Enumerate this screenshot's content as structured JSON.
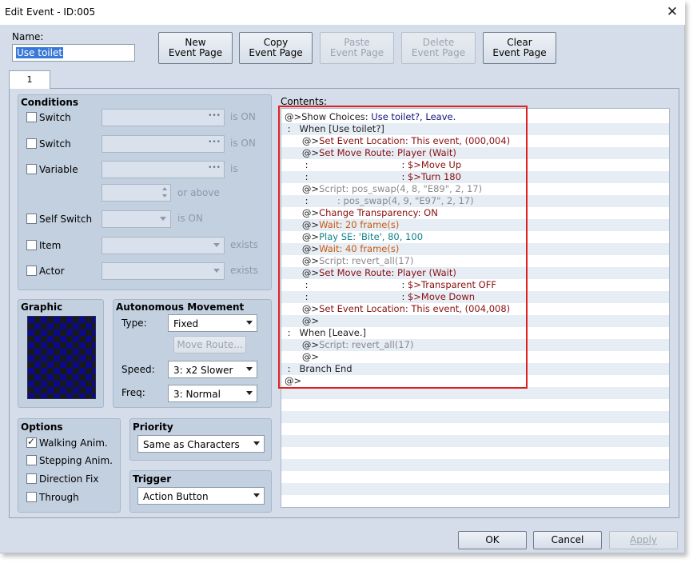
{
  "window": {
    "title": "Edit Event - ID:005",
    "close_icon": "close-icon"
  },
  "name": {
    "label": "Name:",
    "value": "Use toilet"
  },
  "toolbar": [
    {
      "label1": "New",
      "label2": "Event Page",
      "enabled": true
    },
    {
      "label1": "Copy",
      "label2": "Event Page",
      "enabled": true
    },
    {
      "label1": "Paste",
      "label2": "Event Page",
      "enabled": false
    },
    {
      "label1": "Delete",
      "label2": "Event Page",
      "enabled": false
    },
    {
      "label1": "Clear",
      "label2": "Event Page",
      "enabled": true
    }
  ],
  "tabs": [
    {
      "label": "1"
    }
  ],
  "conditions": {
    "title": "Conditions",
    "switch1": {
      "label": "Switch",
      "suffix": "is ON"
    },
    "switch2": {
      "label": "Switch",
      "suffix": "is ON"
    },
    "variable": {
      "label": "Variable",
      "suffix": "is",
      "or_above": "or above"
    },
    "self_switch": {
      "label": "Self Switch",
      "suffix": "is ON"
    },
    "item": {
      "label": "Item",
      "suffix": "exists"
    },
    "actor": {
      "label": "Actor",
      "suffix": "exists"
    }
  },
  "graphic": {
    "title": "Graphic"
  },
  "autonomous": {
    "title": "Autonomous Movement",
    "type_label": "Type:",
    "type_value": "Fixed",
    "move_route": "Move Route...",
    "speed_label": "Speed:",
    "speed_value": "3: x2 Slower",
    "freq_label": "Freq:",
    "freq_value": "3: Normal"
  },
  "options": {
    "title": "Options",
    "walking": {
      "label": "Walking Anim.",
      "checked": true
    },
    "stepping": {
      "label": "Stepping Anim.",
      "checked": false
    },
    "direction_fix": {
      "label": "Direction Fix",
      "checked": false
    },
    "through": {
      "label": "Through",
      "checked": false
    }
  },
  "priority": {
    "title": "Priority",
    "value": "Same as Characters"
  },
  "trigger": {
    "title": "Trigger",
    "value": "Action Button"
  },
  "contents": {
    "label": "Contents:",
    "lines": [
      {
        "parts": [
          {
            "t": "@>Show Choices: ",
            "c": "black"
          },
          {
            "t": "Use toilet?, Leave.",
            "c": "navy"
          }
        ]
      },
      {
        "parts": [
          {
            "t": " :   When [Use toilet?]",
            "c": "black"
          }
        ]
      },
      {
        "parts": [
          {
            "t": "      @>",
            "c": "black"
          },
          {
            "t": "Set Event Location: This event, (000,004)",
            "c": "red"
          }
        ]
      },
      {
        "parts": [
          {
            "t": "      @>",
            "c": "black"
          },
          {
            "t": "Set Move Route: Player (Wait)",
            "c": "red"
          }
        ]
      },
      {
        "parts": [
          {
            "t": "       :                                : ",
            "c": "black"
          },
          {
            "t": "$>Move Up",
            "c": "red"
          }
        ]
      },
      {
        "parts": [
          {
            "t": "       :                                : ",
            "c": "black"
          },
          {
            "t": "$>Turn 180",
            "c": "red"
          }
        ]
      },
      {
        "parts": [
          {
            "t": "      @>",
            "c": "black"
          },
          {
            "t": "Script: pos_swap(4, 8, \"E89\", 2, 17)",
            "c": "gray"
          }
        ]
      },
      {
        "parts": [
          {
            "t": "       :",
            "c": "black"
          },
          {
            "t": "          : pos_swap(4, 9, \"E97\", 2, 17)",
            "c": "gray"
          }
        ]
      },
      {
        "parts": [
          {
            "t": "      @>",
            "c": "black"
          },
          {
            "t": "Change Transparency: ON",
            "c": "red"
          }
        ]
      },
      {
        "parts": [
          {
            "t": "      @>",
            "c": "black"
          },
          {
            "t": "Wait: 20 frame(s)",
            "c": "orange"
          }
        ]
      },
      {
        "parts": [
          {
            "t": "      @>",
            "c": "black"
          },
          {
            "t": "Play SE: 'Bite', 80, 100",
            "c": "teal"
          }
        ]
      },
      {
        "parts": [
          {
            "t": "      @>",
            "c": "black"
          },
          {
            "t": "Wait: 40 frame(s)",
            "c": "orange"
          }
        ]
      },
      {
        "parts": [
          {
            "t": "      @>",
            "c": "black"
          },
          {
            "t": "Script: revert_all(17)",
            "c": "gray"
          }
        ]
      },
      {
        "parts": [
          {
            "t": "      @>",
            "c": "black"
          },
          {
            "t": "Set Move Route: Player (Wait)",
            "c": "red"
          }
        ]
      },
      {
        "parts": [
          {
            "t": "       :                                : ",
            "c": "black"
          },
          {
            "t": "$>Transparent OFF",
            "c": "red"
          }
        ]
      },
      {
        "parts": [
          {
            "t": "       :                                : ",
            "c": "black"
          },
          {
            "t": "$>Move Down",
            "c": "red"
          }
        ]
      },
      {
        "parts": [
          {
            "t": "      @>",
            "c": "black"
          },
          {
            "t": "Set Event Location: This event, (004,008)",
            "c": "red"
          }
        ]
      },
      {
        "parts": [
          {
            "t": "      @>",
            "c": "black"
          }
        ]
      },
      {
        "parts": [
          {
            "t": " :   When [Leave.]",
            "c": "black"
          }
        ]
      },
      {
        "parts": [
          {
            "t": "      @>",
            "c": "black"
          },
          {
            "t": "Script: revert_all(17)",
            "c": "gray"
          }
        ]
      },
      {
        "parts": [
          {
            "t": "      @>",
            "c": "black"
          }
        ]
      },
      {
        "parts": [
          {
            "t": " :   Branch End",
            "c": "black"
          }
        ]
      },
      {
        "parts": [
          {
            "t": "@>",
            "c": "black"
          }
        ]
      }
    ]
  },
  "footer": {
    "ok": "OK",
    "cancel": "Cancel",
    "apply": "Apply"
  }
}
